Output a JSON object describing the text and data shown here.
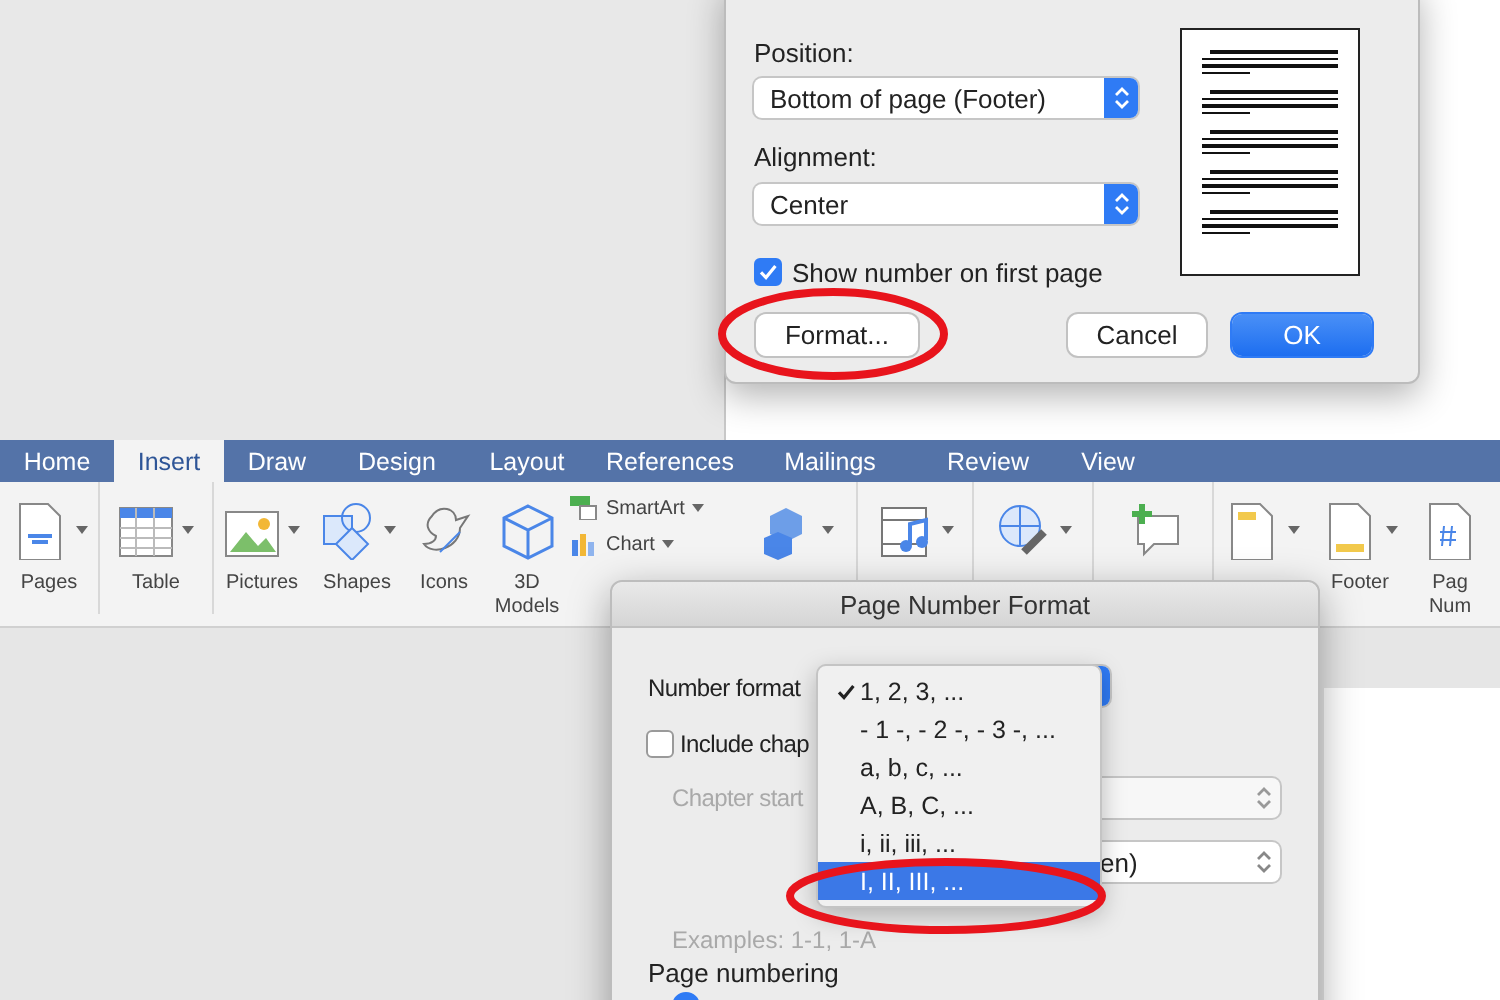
{
  "page_numbers_dialog": {
    "position_label": "Position:",
    "position_value": "Bottom of page (Footer)",
    "alignment_label": "Alignment:",
    "alignment_value": "Center",
    "show_on_first_page": {
      "label": "Show number on first page",
      "checked": true
    },
    "buttons": [
      {
        "label": "Format...",
        "kind": "plain",
        "highlighted": true
      },
      {
        "label": "Cancel",
        "kind": "plain",
        "highlighted": false
      },
      {
        "label": "OK",
        "kind": "default",
        "highlighted": false
      }
    ]
  },
  "ribbon": {
    "tabs": [
      {
        "label": "Home",
        "selected": false
      },
      {
        "label": "Insert",
        "selected": true
      },
      {
        "label": "Draw",
        "selected": false
      },
      {
        "label": "Design",
        "selected": false
      },
      {
        "label": "Layout",
        "selected": false
      },
      {
        "label": "References",
        "selected": false
      },
      {
        "label": "Mailings",
        "selected": false
      },
      {
        "label": "Review",
        "selected": false
      },
      {
        "label": "View",
        "selected": false
      }
    ],
    "items": [
      {
        "kind": "pages",
        "label": [
          "Pages"
        ]
      },
      {
        "kind": "table",
        "label": [
          "Table"
        ]
      },
      {
        "kind": "pictures",
        "label": [
          "Pictures"
        ]
      },
      {
        "kind": "shapes",
        "label": [
          "Shapes"
        ]
      },
      {
        "kind": "icons",
        "label": [
          "Icons"
        ]
      },
      {
        "kind": "models",
        "label": [
          "3D",
          "Models"
        ]
      },
      {
        "kind": "stack",
        "entries": [
          "SmartArt",
          "Chart"
        ]
      },
      {
        "kind": "addins"
      },
      {
        "kind": "media"
      },
      {
        "kind": "links"
      },
      {
        "kind": "comment"
      },
      {
        "kind": "header"
      },
      {
        "kind": "footer",
        "label": [
          "Footer"
        ]
      },
      {
        "kind": "pagenum",
        "label": [
          "Pag",
          "Num"
        ]
      }
    ]
  },
  "page_number_format_dialog": {
    "title": "Page Number Format",
    "number_format_label": "Number format",
    "include_chapter": {
      "label": "Include chap",
      "checked": false
    },
    "chapter_start_label": "Chapter start",
    "separator_value": "en)",
    "examples": "Examples:  1-1, 1-A",
    "page_numbering_label": "Page numbering",
    "start_radio": {
      "selected": true
    },
    "format_options": [
      {
        "label": "1, 2, 3, ...",
        "checked": true,
        "selected": false,
        "highlighted": false
      },
      {
        "label": "- 1 -, - 2 -, - 3 -, ...",
        "checked": false,
        "selected": false,
        "highlighted": false
      },
      {
        "label": "a, b, c, ...",
        "checked": false,
        "selected": false,
        "highlighted": false
      },
      {
        "label": "A, B, C, ...",
        "checked": false,
        "selected": false,
        "highlighted": false
      },
      {
        "label": "i, ii, iii, ...",
        "checked": false,
        "selected": false,
        "highlighted": false
      },
      {
        "label": "I, II, III, ...",
        "checked": false,
        "selected": true,
        "highlighted": true
      }
    ]
  }
}
